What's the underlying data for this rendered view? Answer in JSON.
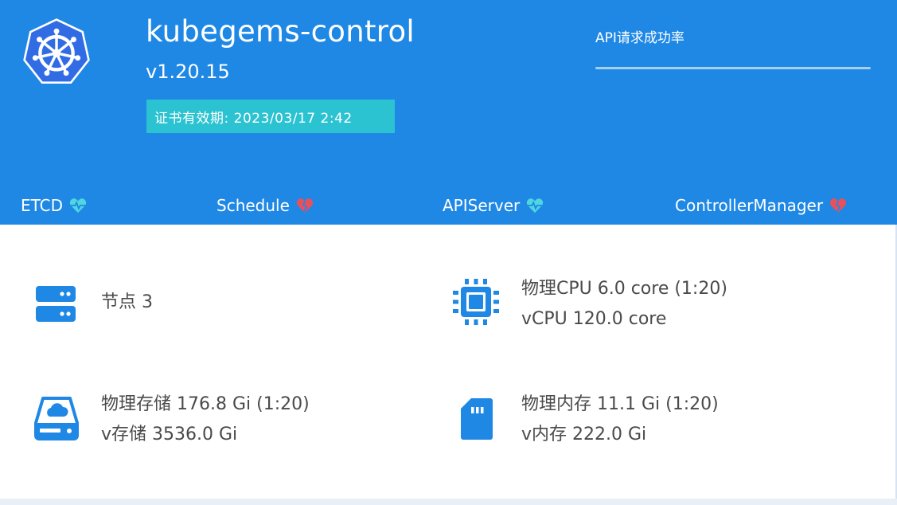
{
  "cluster": {
    "name": "kubegems-control",
    "version": "v1.20.15",
    "cert_expiry": "证书有效期: 2023/03/17 2:42"
  },
  "api": {
    "title": "API请求成功率"
  },
  "components": [
    {
      "label": "ETCD",
      "status": "healthy",
      "icon": "heartbeat-icon"
    },
    {
      "label": "Schedule",
      "status": "unhealthy",
      "icon": "broken-heart-icon"
    },
    {
      "label": "APIServer",
      "status": "healthy",
      "icon": "heartbeat-icon"
    },
    {
      "label": "ControllerManager",
      "status": "unhealthy",
      "icon": "broken-heart-icon"
    }
  ],
  "stats": {
    "nodes": {
      "text": "节点 3",
      "icon": "server-icon"
    },
    "cpu": {
      "line1": "物理CPU 6.0 core (1:20)",
      "line2": "vCPU 120.0 core",
      "icon": "cpu-icon"
    },
    "storage": {
      "line1": "物理存储 176.8 Gi (1:20)",
      "line2": "v存储 3536.0 Gi",
      "icon": "cloud-storage-icon"
    },
    "memory": {
      "line1": "物理内存 11.1 Gi  (1:20)",
      "line2": "v内存 222.0 Gi",
      "icon": "memory-card-icon"
    }
  },
  "colors": {
    "header_bg": "#1f88e5",
    "badge_bg": "#2bc3d2",
    "healthy": "#4fd6e0",
    "unhealthy": "#e8505b",
    "icon_blue": "#1f88e5"
  }
}
